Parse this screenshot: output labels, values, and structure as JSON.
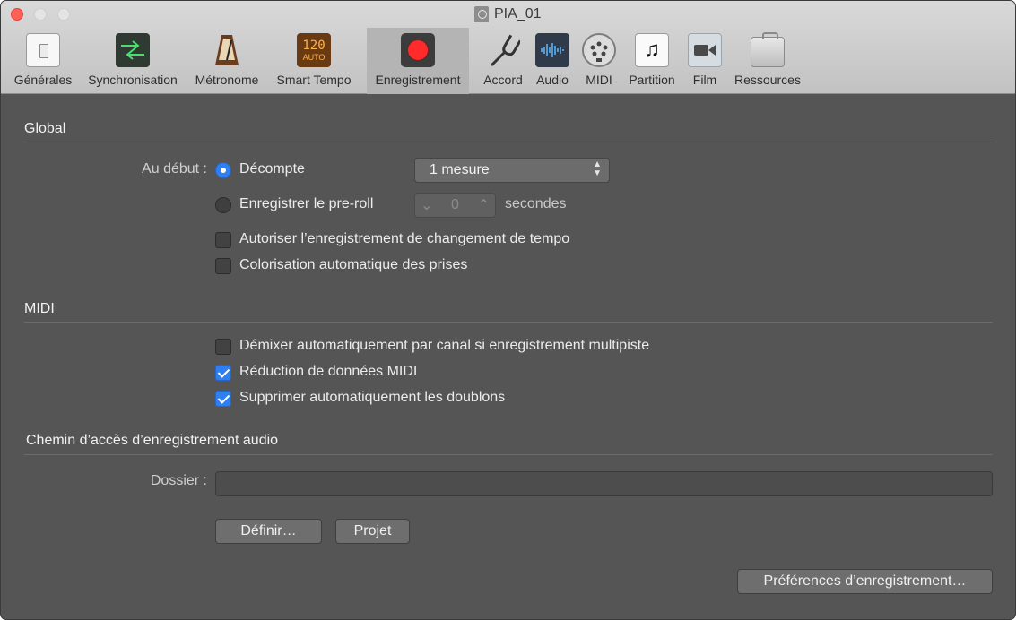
{
  "window": {
    "title": "PIA_01"
  },
  "toolbar": {
    "tabs": [
      {
        "label": "Générales",
        "icon": "switch-icon"
      },
      {
        "label": "Synchronisation",
        "icon": "sync-arrows-icon"
      },
      {
        "label": "Métronome",
        "icon": "metronome-icon"
      },
      {
        "label": "Smart Tempo",
        "icon": "smart-tempo-icon",
        "icon_text": "120",
        "icon_subtext": "AUTO"
      },
      {
        "label": "Enregistrement",
        "icon": "record-icon",
        "selected": true
      },
      {
        "label": "Accord",
        "icon": "tuning-fork-icon"
      },
      {
        "label": "Audio",
        "icon": "waveform-icon"
      },
      {
        "label": "MIDI",
        "icon": "midi-connector-icon"
      },
      {
        "label": "Partition",
        "icon": "music-note-icon",
        "icon_text": "♫"
      },
      {
        "label": "Film",
        "icon": "video-camera-icon"
      },
      {
        "label": "Ressources",
        "icon": "briefcase-icon"
      }
    ]
  },
  "global": {
    "title": "Global",
    "start_label": "Au début :",
    "count_in_label": "Décompte",
    "count_in_value": "1 mesure",
    "preroll_label": "Enregistrer le pre-roll",
    "preroll_value": "0",
    "preroll_unit": "secondes",
    "allow_tempo_label": "Autoriser l’enregistrement de changement de tempo",
    "auto_color_label": "Colorisation automatique des prises"
  },
  "midi": {
    "title": "MIDI",
    "demix_label": "Démixer automatiquement par canal si enregistrement multipiste",
    "reduction_label": "Réduction de données MIDI",
    "remove_duplicates_label": "Supprimer automatiquement les doublons"
  },
  "path": {
    "title": "Chemin d’accès d’enregistrement audio",
    "folder_label": "Dossier :",
    "folder_value": "",
    "define_button": "Définir…",
    "project_button": "Projet"
  },
  "footer": {
    "prefs_button": "Préférences d’enregistrement…"
  },
  "colors": {
    "accent": "#2f7ff0",
    "record": "#ff2b2b",
    "background": "#555555"
  }
}
